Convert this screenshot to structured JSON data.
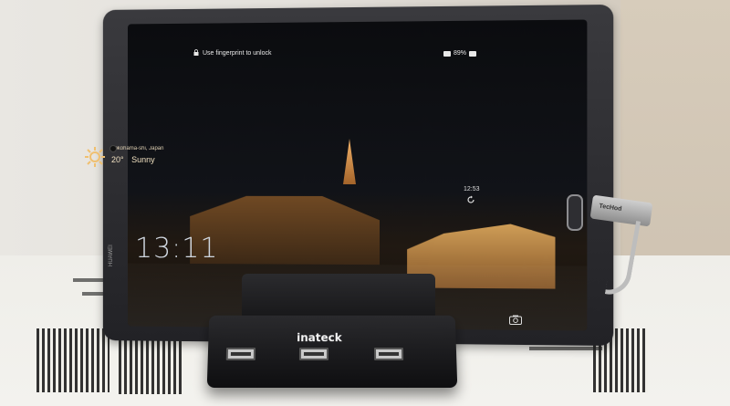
{
  "lockscreen": {
    "unlock_hint": "Use fingerprint to unlock",
    "battery": "89%",
    "weather_location": "Yokohama-shi, Japan",
    "temperature": "20°",
    "condition": "Sunny",
    "time_small": "12:53",
    "time_big": "13:11"
  },
  "device": {
    "side_brand": "HUAWEI"
  },
  "dock": {
    "brand": "inateck"
  },
  "cable": {
    "label": "TecHod"
  },
  "icons": {
    "lock": "lock-icon",
    "wifi": "wifi-icon",
    "battery": "battery-icon",
    "weather": "sun-icon",
    "refresh": "refresh-icon",
    "camera": "camera-icon"
  },
  "colors": {
    "dock": "#151517",
    "tablet_bezel": "#2a2a2e",
    "screen_bg": "#0b0c0f",
    "table": "#f3f2ee"
  }
}
